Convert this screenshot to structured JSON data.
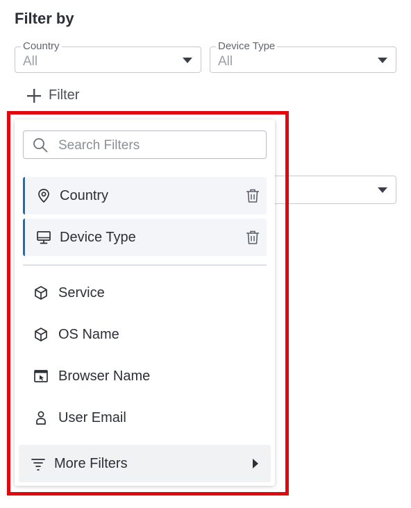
{
  "header": {
    "title": "Filter by"
  },
  "selects": [
    {
      "legend": "Country",
      "value": "All"
    },
    {
      "legend": "Device Type",
      "value": "All"
    }
  ],
  "add_filter": {
    "label": "Filter",
    "icon": "plus-icon"
  },
  "dropdown": {
    "search": {
      "placeholder": "Search Filters",
      "value": ""
    },
    "selected_items": [
      {
        "label": "Country",
        "icon": "location-pin-icon"
      },
      {
        "label": "Device Type",
        "icon": "monitor-icon"
      }
    ],
    "options": [
      {
        "label": "Service",
        "icon": "cube-icon"
      },
      {
        "label": "OS Name",
        "icon": "cube-icon"
      },
      {
        "label": "Browser Name",
        "icon": "browser-window-icon"
      },
      {
        "label": "User Email",
        "icon": "user-icon"
      }
    ],
    "more": {
      "label": "More Filters",
      "icon": "filter-lines-icon"
    }
  },
  "colors": {
    "highlight": "#e0070d",
    "selected_accent": "#1a6fb5",
    "selected_bg": "#f3f5f8"
  }
}
